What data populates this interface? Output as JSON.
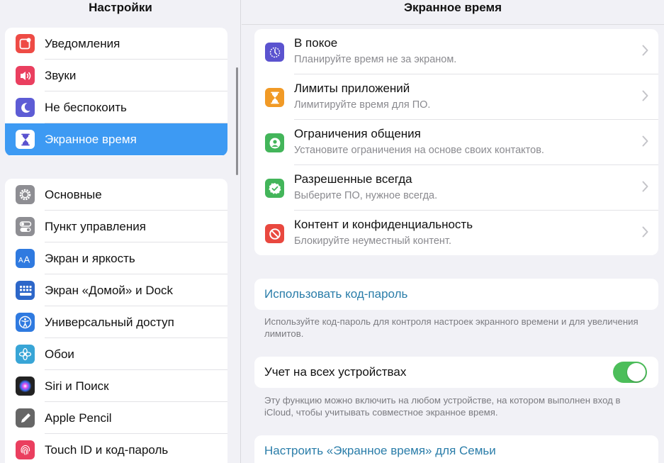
{
  "sidebar": {
    "title": "Настройки",
    "group1": [
      {
        "label": "Уведомления",
        "icon": "notifications-icon",
        "color": "#ee4b45"
      },
      {
        "label": "Звуки",
        "icon": "speaker-icon",
        "color": "#ea3f5f"
      },
      {
        "label": "Не беспокоить",
        "icon": "moon-icon",
        "color": "#5d5cd5"
      },
      {
        "label": "Экранное время",
        "icon": "hourglass-icon",
        "color": "#5b53cf",
        "selected": true
      }
    ],
    "group2": [
      {
        "label": "Основные",
        "icon": "gear-icon",
        "color": "#8e8e93"
      },
      {
        "label": "Пункт управления",
        "icon": "toggles-icon",
        "color": "#8e8e93"
      },
      {
        "label": "Экран и яркость",
        "icon": "text-size-icon",
        "color": "#2f7ae0"
      },
      {
        "label": "Экран «Домой» и Dock",
        "icon": "grid-icon",
        "color": "#2d67c9"
      },
      {
        "label": "Универсальный доступ",
        "icon": "accessibility-icon",
        "color": "#2f7ae0"
      },
      {
        "label": "Обои",
        "icon": "flower-icon",
        "color": "#38a5d6"
      },
      {
        "label": "Siri и Поиск",
        "icon": "siri-icon",
        "color": "#222222"
      },
      {
        "label": "Apple Pencil",
        "icon": "pencil-icon",
        "color": "#666666"
      },
      {
        "label": "Touch ID и код-пароль",
        "icon": "fingerprint-icon",
        "color": "#ea3f5f"
      }
    ]
  },
  "main": {
    "title": "Экранное время",
    "features": [
      {
        "title": "В покое",
        "subtitle": "Планируйте время не за экраном.",
        "icon": "downtime-icon",
        "color": "#5b53cf"
      },
      {
        "title": "Лимиты приложений",
        "subtitle": "Лимитируйте время для ПО.",
        "icon": "hourglass-icon",
        "color": "#f19a26"
      },
      {
        "title": "Ограничения общения",
        "subtitle": "Установите ограничения на основе своих контактов.",
        "icon": "contact-icon",
        "color": "#43b55a"
      },
      {
        "title": "Разрешенные всегда",
        "subtitle": "Выберите ПО, нужное всегда.",
        "icon": "checkmark-badge-icon",
        "color": "#43b55a"
      },
      {
        "title": "Контент и конфиденциальность",
        "subtitle": "Блокируйте неуместный контент.",
        "icon": "restriction-icon",
        "color": "#e9483f"
      }
    ],
    "passcode": {
      "link": "Использовать код-пароль",
      "footer": "Используйте код-пароль для контроля настроек экранного времени и для увеличения лимитов."
    },
    "devices": {
      "label": "Учет на всех устройствах",
      "toggle_on": true,
      "toggle_color": "#4cbe5a",
      "footer": "Эту функцию можно включить на любом устройстве, на котором выполнен вход в iCloud, чтобы учитывать совместное экранное время."
    },
    "family": {
      "link": "Настроить «Экранное время» для Семьи"
    }
  },
  "colors": {
    "accent": "#3d9af3",
    "link": "#2a7da9"
  }
}
